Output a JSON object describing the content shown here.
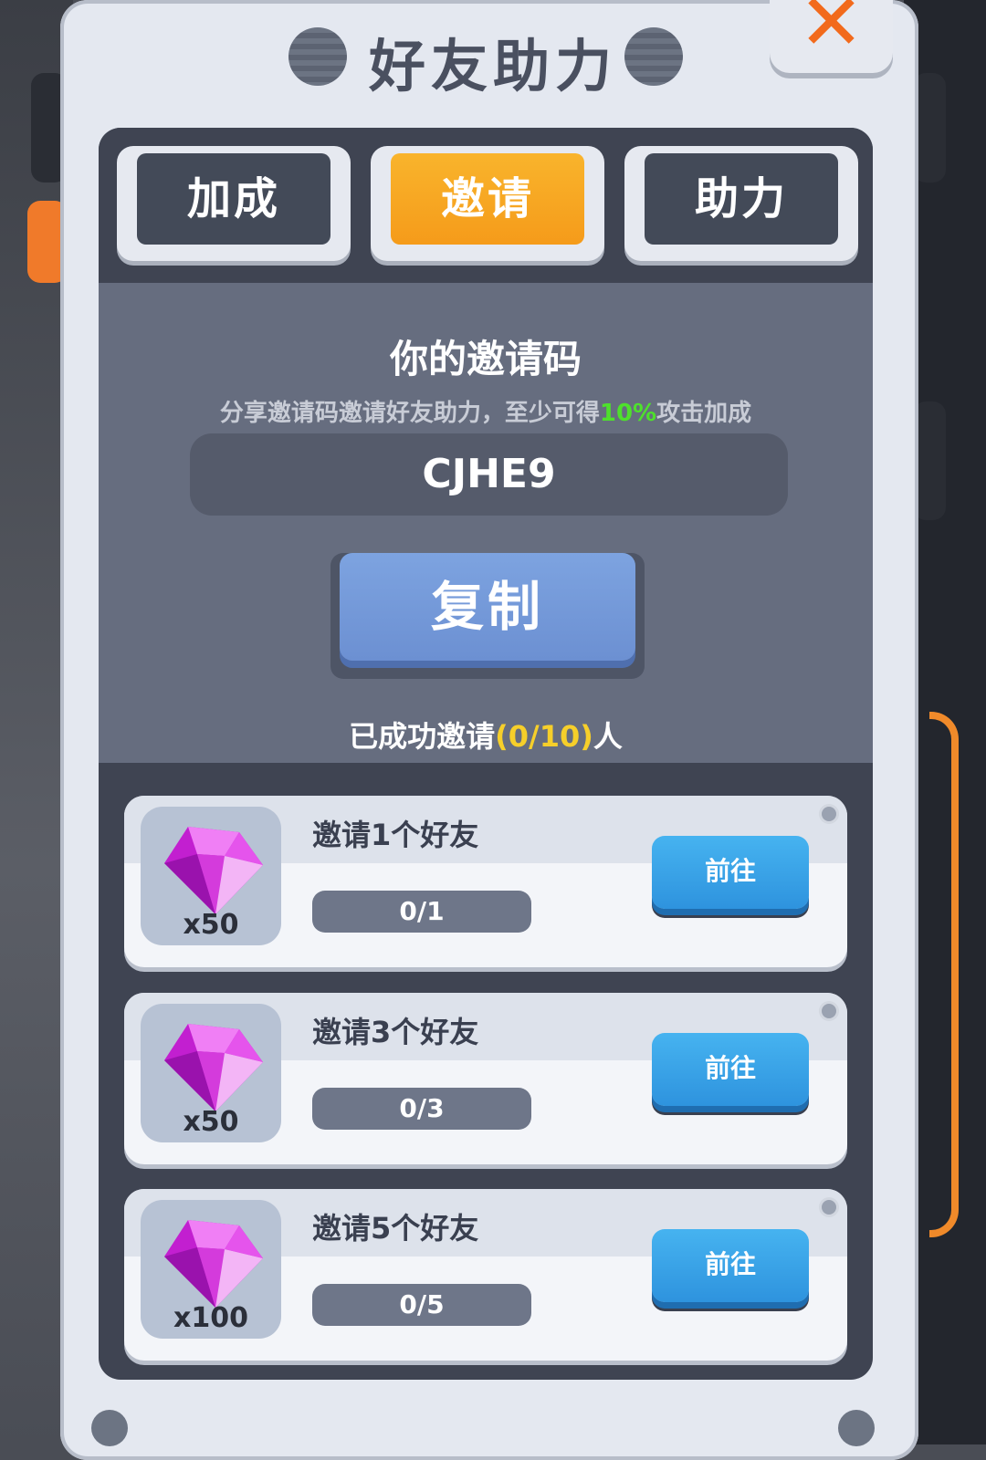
{
  "header": {
    "title": "好友助力",
    "close_label": "✕"
  },
  "tabs": [
    {
      "label": "加成",
      "active": false
    },
    {
      "label": "邀请",
      "active": true
    },
    {
      "label": "助力",
      "active": false
    }
  ],
  "invite": {
    "title": "你的邀请码",
    "desc_prefix": "分享邀请码邀请好友助力，至少可得",
    "desc_highlight": "10%",
    "desc_suffix": "攻击加成",
    "code": "CJHE9",
    "copy_label": "复制",
    "invited_prefix": "已成功邀请",
    "invited_count": "(0/10)",
    "invited_suffix": "人"
  },
  "rewards": [
    {
      "task": "邀请1个好友",
      "progress": "0/1",
      "qty": "x50",
      "button": "前往",
      "icon": "purple-gem-icon"
    },
    {
      "task": "邀请3个好友",
      "progress": "0/3",
      "qty": "x50",
      "button": "前往",
      "icon": "purple-gem-icon"
    },
    {
      "task": "邀请5个好友",
      "progress": "0/5",
      "qty": "x100",
      "button": "前往",
      "icon": "purple-gem-icon"
    }
  ],
  "colors": {
    "accent": "#f59b1a",
    "highlight": "#4ee02c",
    "count": "#f6cf2a",
    "go_button": "#2e93de"
  }
}
